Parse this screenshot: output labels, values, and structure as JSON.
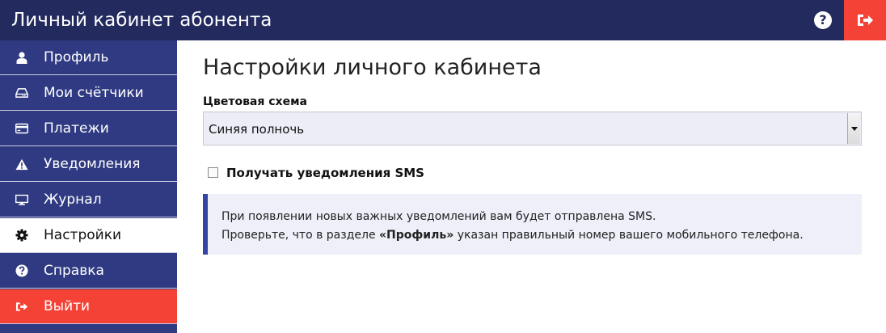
{
  "header": {
    "title": "Личный кабинет абонента",
    "help_icon": "question-circle-icon",
    "logout_icon": "sign-out-icon",
    "logout_color": "#f44336",
    "bar_color": "#222a5e"
  },
  "sidebar": {
    "items": [
      {
        "label": "Профиль",
        "icon": "user-icon"
      },
      {
        "label": "Мои счётчики",
        "icon": "meter-icon"
      },
      {
        "label": "Платежи",
        "icon": "credit-card-icon"
      },
      {
        "label": "Уведомления",
        "icon": "warning-icon"
      },
      {
        "label": "Журнал",
        "icon": "monitor-icon"
      },
      {
        "label": "Настройки",
        "icon": "gear-icon",
        "active": true
      },
      {
        "label": "Справка",
        "icon": "question-circle-icon"
      },
      {
        "label": "Выйти",
        "icon": "sign-out-icon"
      }
    ],
    "bg_color": "#2f3a82",
    "exit_color": "#f44336"
  },
  "main": {
    "title": "Настройки личного кабинета",
    "color_scheme": {
      "label": "Цветовая схема",
      "value": "Синяя полночь"
    },
    "sms": {
      "label": "Получать уведомления SMS",
      "checked": false
    },
    "info": {
      "line1": "При появлении новых важных уведомлений вам будет отправлена SMS.",
      "line2_prefix": "Проверьте, что в разделе ",
      "line2_link": "«Профиль»",
      "line2_suffix": " указан правильный номер вашего мобильного телефона."
    }
  }
}
